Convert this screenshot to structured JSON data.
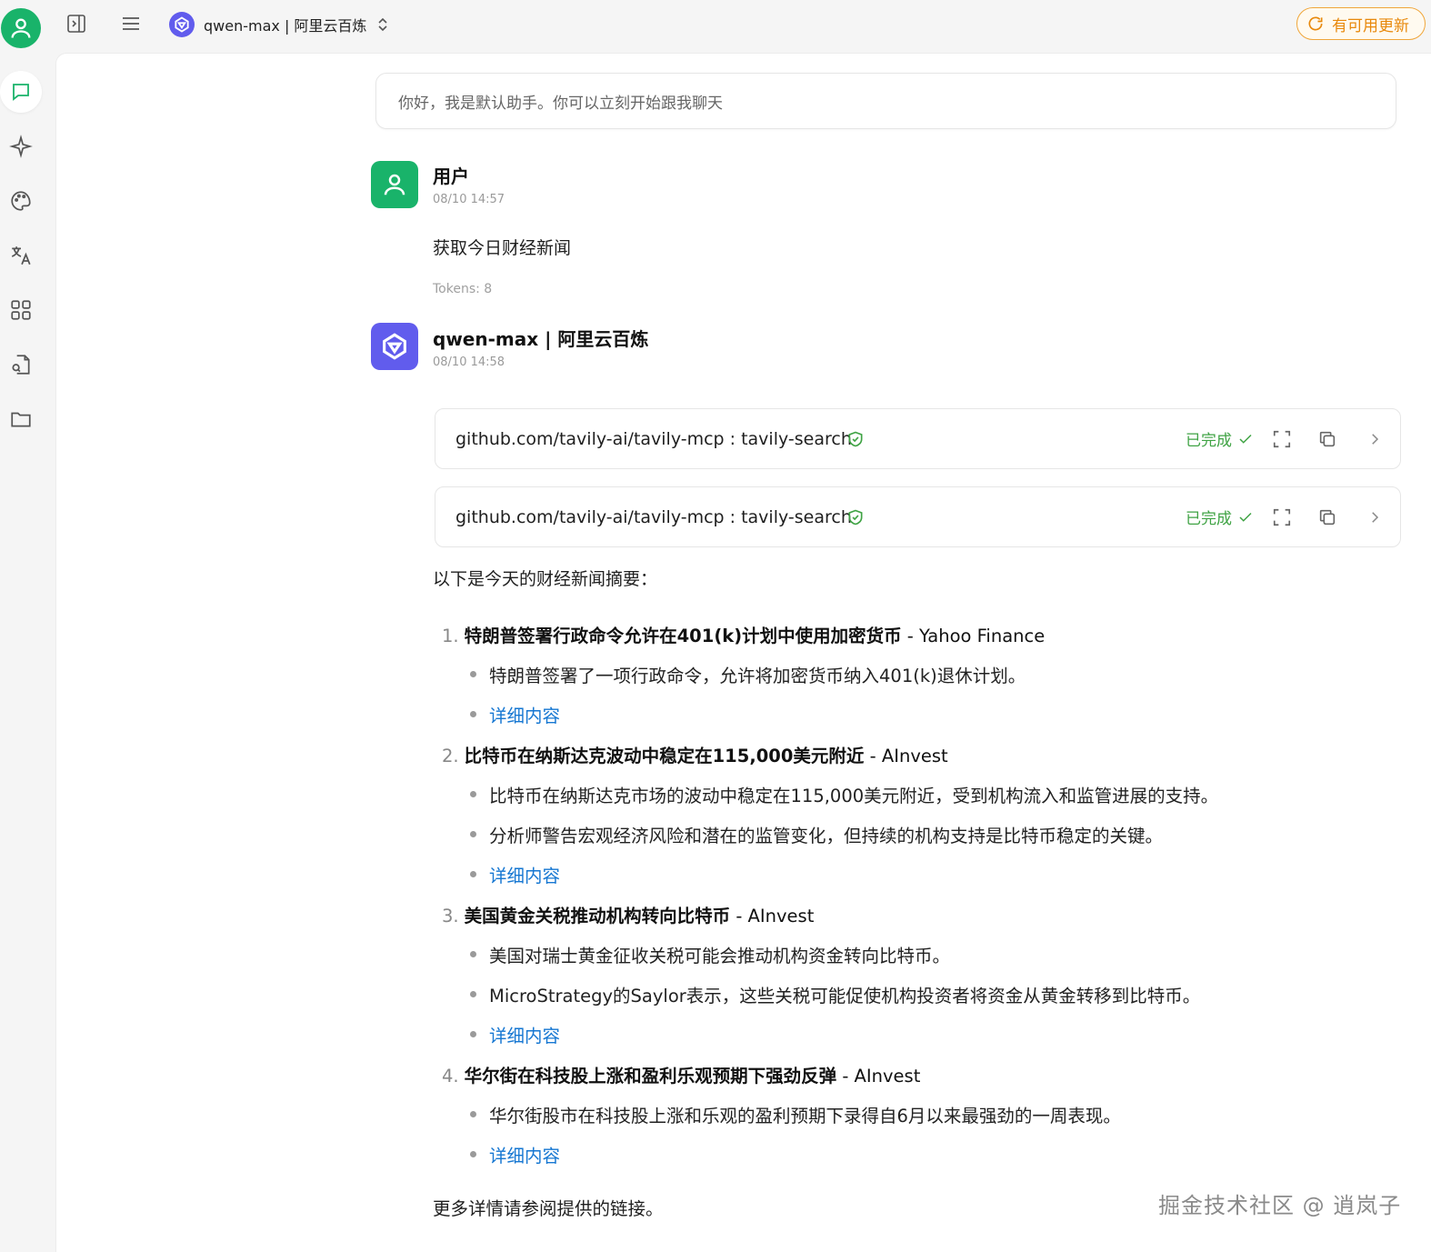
{
  "topbar": {
    "model_label": "qwen-max | 阿里云百炼",
    "update_label": "有可用更新"
  },
  "colors": {
    "accent_green": "#19b36a",
    "brand_purple": "#615ced",
    "link_blue": "#1677d2",
    "status_green": "#3fa344",
    "update_orange": "#e8890c"
  },
  "sidebar": {
    "items": [
      {
        "icon": "chat-icon"
      },
      {
        "icon": "sparkle-icon"
      },
      {
        "icon": "palette-icon"
      },
      {
        "icon": "translate-icon"
      },
      {
        "icon": "apps-grid-icon"
      },
      {
        "icon": "file-search-icon"
      },
      {
        "icon": "folder-icon"
      }
    ]
  },
  "system_prompt": "你好，我是默认助手。你可以立刻开始跟我聊天",
  "user_message": {
    "sender": "用户",
    "time": "08/10 14:57",
    "text": "获取今日财经新闻",
    "tokens": "Tokens: 8"
  },
  "assistant_message": {
    "sender": "qwen-max | 阿里云百炼",
    "time": "08/10 14:58",
    "tool_calls": [
      {
        "name": "github.com/tavily-ai/tavily-mcp : tavily-search",
        "status": "已完成"
      },
      {
        "name": "github.com/tavily-ai/tavily-mcp : tavily-search",
        "status": "已完成"
      }
    ],
    "intro": "以下是今天的财经新闻摘要：",
    "news": [
      {
        "num": "1.",
        "title": "特朗普签署行政命令允许在401(k)计划中使用加密货币",
        "source": " - Yahoo Finance",
        "bullets": [
          "特朗普签署了一项行政命令，允许将加密货币纳入401(k)退休计划。"
        ],
        "link": "详细内容"
      },
      {
        "num": "2.",
        "title": "比特币在纳斯达克波动中稳定在115,000美元附近",
        "source": " - AInvest",
        "bullets": [
          "比特币在纳斯达克市场的波动中稳定在115,000美元附近，受到机构流入和监管进展的支持。",
          "分析师警告宏观经济风险和潜在的监管变化，但持续的机构支持是比特币稳定的关键。"
        ],
        "link": "详细内容"
      },
      {
        "num": "3.",
        "title": "美国黄金关税推动机构转向比特币",
        "source": " - AInvest",
        "bullets": [
          "美国对瑞士黄金征收关税可能会推动机构资金转向比特币。",
          "MicroStrategy的Saylor表示，这些关税可能促使机构投资者将资金从黄金转移到比特币。"
        ],
        "link": "详细内容"
      },
      {
        "num": "4.",
        "title": "华尔街在科技股上涨和盈利乐观预期下强劲反弹",
        "source": " - AInvest",
        "bullets": [
          "华尔街股市在科技股上涨和乐观的盈利预期下录得自6月以来最强劲的一周表现。"
        ],
        "link": "详细内容"
      }
    ],
    "footer": "更多详情请参阅提供的链接。"
  },
  "watermark": "掘金技术社区 @ 逍岚子"
}
